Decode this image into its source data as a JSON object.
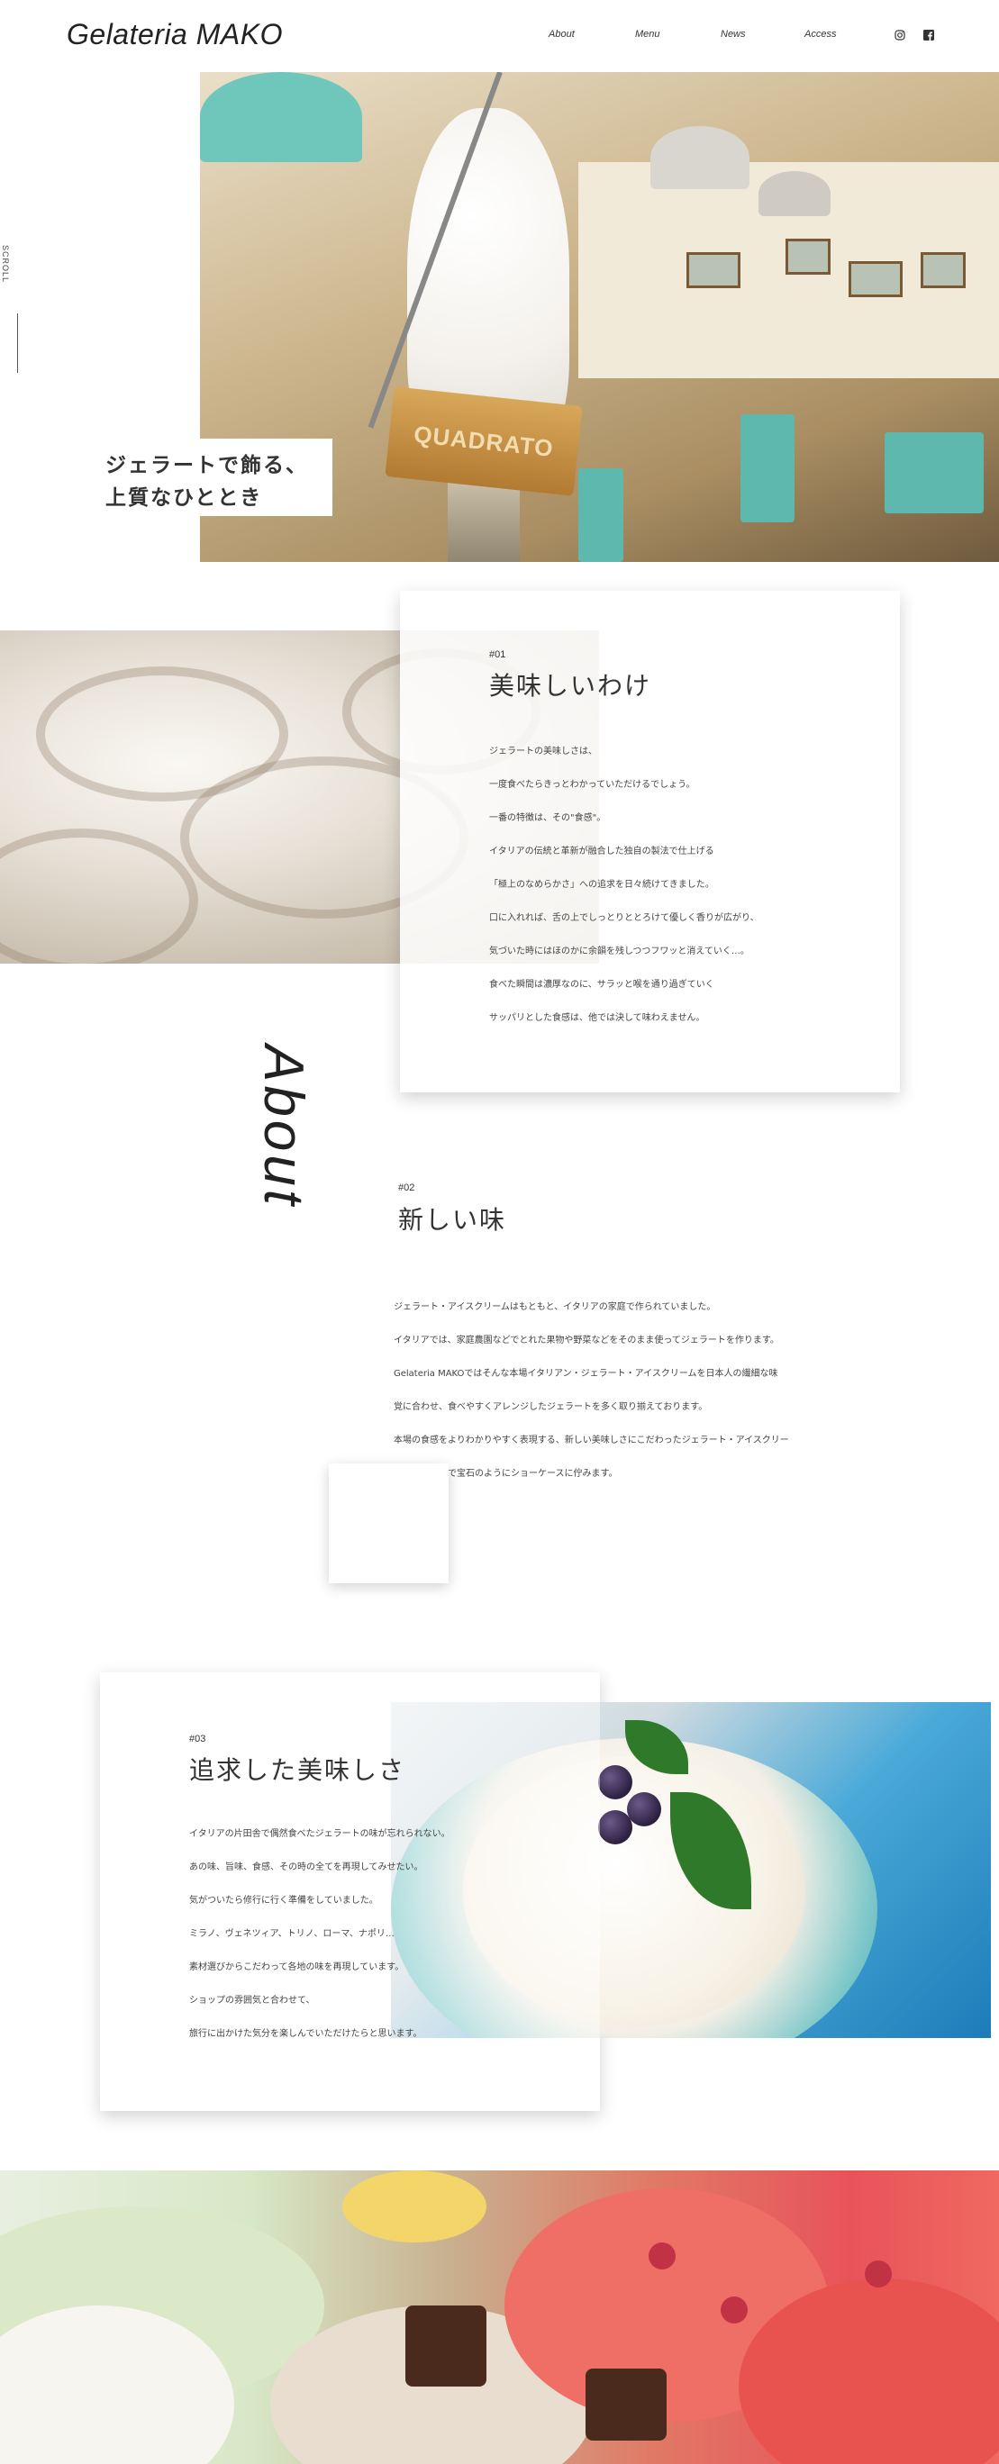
{
  "header": {
    "logo": "Gelateria MAKO",
    "nav": [
      {
        "label": "About"
      },
      {
        "label": "Menu"
      },
      {
        "label": "News"
      },
      {
        "label": "Access"
      }
    ],
    "social": [
      "instagram-icon",
      "facebook-icon"
    ]
  },
  "hero": {
    "cup_text": "QUADRATO",
    "caption_line1": "ジェラートで飾る、",
    "caption_line2": "上質なひととき",
    "scroll_label": "SCROLL"
  },
  "section1": {
    "number": "#01",
    "title": "美味しいわけ",
    "lines": [
      "ジェラートの美味しさは、",
      "一度食べたらきっとわかっていただけるでしょう。",
      "一番の特徴は、その\"食感\"。",
      "イタリアの伝統と革新が融合した独自の製法で仕上げる",
      "「極上のなめらかさ」への追求を日々続けてきました。",
      "口に入れれば、舌の上でしっとりととろけて優しく香りが広がり、",
      "気づいた時にはほのかに余韻を残しつつフワッと消えていく…。",
      "食べた瞬間は濃厚なのに、サラッと喉を通り過ぎていく",
      "サッパリとした食感は、他では決して味わえません。"
    ]
  },
  "about_label": "About",
  "section2": {
    "number": "#02",
    "title": "新しい味",
    "lines": [
      "ジェラート・アイスクリームはもともと、イタリアの家庭で作られていました。",
      "イタリアでは、家庭農園などでとれた果物や野菜などをそのまま使ってジェラートを作ります。",
      "Gelateria MAKOではそんな本場イタリアン・ジェラート・アイスクリームを日本人の繊細な味",
      "覚に合わせ、食べやすくアレンジしたジェラートを多く取り揃えております。",
      "本場の食感をよりわかりやすく表現する、新しい美味しさにこだわったジェラート・アイスクリー",
      "ムたちがまるで宝石のようにショーケースに佇みます。"
    ]
  },
  "section3": {
    "number": "#03",
    "title": "追求した美味しさ",
    "lines": [
      "イタリアの片田舎で偶然食べたジェラートの味が忘れられない。",
      "あの味、旨味、食感、その時の全てを再現してみせたい。",
      "気がついたら修行に行く準備をしていました。",
      "ミラノ、ヴェネツィア、トリノ、ローマ、ナポリ…",
      "素材選びからこだわって各地の味を再現しています。",
      "ショップの雰囲気と合わせて、",
      "旅行に出かけた気分を楽しんでいただけたらと思います。"
    ]
  },
  "colors": {
    "text": "#222222",
    "hero_accent": "#5fb8ad",
    "background": "#ffffff"
  }
}
